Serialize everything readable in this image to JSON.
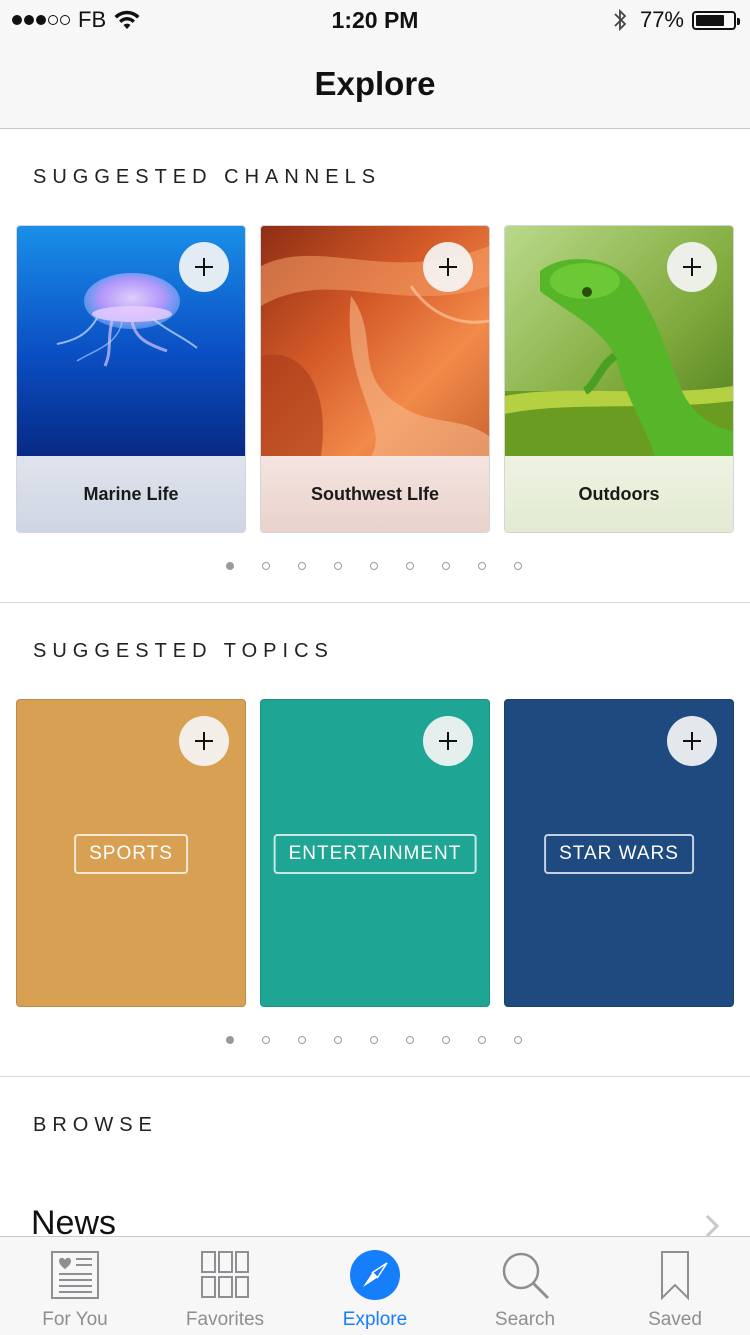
{
  "status_bar": {
    "carrier": "FB",
    "time": "1:20 PM",
    "battery_percent": "77%",
    "battery_level": 0.77,
    "signal_bars_filled": 3,
    "signal_bars_total": 5
  },
  "nav": {
    "title": "Explore"
  },
  "channels": {
    "header": "SUGGESTED CHANNELS",
    "items": [
      {
        "label": "Marine Life",
        "image": "jellyfish"
      },
      {
        "label": "Southwest LIfe",
        "image": "red-sandstone-canyon"
      },
      {
        "label": "Outdoors",
        "image": "green-lizard"
      }
    ],
    "page_count": 9,
    "active_page": 1
  },
  "topics": {
    "header": "SUGGESTED TOPICS",
    "items": [
      {
        "label": "SPORTS",
        "color": "#d8a052"
      },
      {
        "label": "ENTERTAINMENT",
        "color": "#1ea593"
      },
      {
        "label": "STAR WARS",
        "color": "#1f4a80"
      }
    ],
    "page_count": 9,
    "active_page": 1
  },
  "browse": {
    "header": "BROWSE",
    "items": [
      {
        "label": "News"
      }
    ]
  },
  "tab_bar": {
    "tabs": [
      {
        "label": "For You",
        "icon": "newspaper-heart-icon",
        "active": false
      },
      {
        "label": "Favorites",
        "icon": "grid-icon",
        "active": false
      },
      {
        "label": "Explore",
        "icon": "compass-icon",
        "active": true
      },
      {
        "label": "Search",
        "icon": "search-icon",
        "active": false
      },
      {
        "label": "Saved",
        "icon": "bookmark-icon",
        "active": false
      }
    ]
  },
  "colors": {
    "accent": "#147efb",
    "inactive_tab": "#8e8e93"
  }
}
